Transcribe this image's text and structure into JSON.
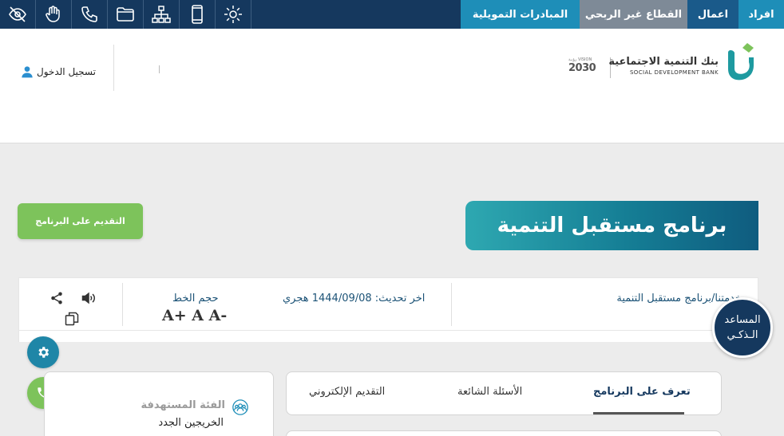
{
  "topbar": {
    "tabs": [
      {
        "label": "افراد",
        "bg": "#1e8eb8",
        "width": 57
      },
      {
        "label": "اعمال",
        "bg": "#1a5a8a",
        "width": 64
      },
      {
        "label": "القطاع غير الربحي",
        "bg": "#7e8a97",
        "width": 135
      },
      {
        "label": "المبادرات التمويلية",
        "bg": "#1e8eb8",
        "width": 149
      }
    ],
    "icons": [
      "accessibility-icon",
      "sign-language-icon",
      "phone-icon",
      "folder-icon",
      "sitemap-icon",
      "mobile-icon",
      "settings-gear-icon"
    ]
  },
  "header": {
    "login_label": "تسجيل الدخول",
    "bank_name_ar": "بنك التنمية الاجتماعية",
    "bank_name_en": "SOCIAL DEVELOPMENT BANK",
    "vision_label": "رؤيـة VISION",
    "vision_year": "2030"
  },
  "page": {
    "title": "برنامج مستقبل التنمية",
    "apply_button": "التقديم على البرنامج",
    "breadcrumb": "خدمتنا/برنامج مستقبل التنمية",
    "last_update": "اخر تحديث: 1444/09/08 هجري",
    "font_size_label": "حجم الخط",
    "font_sizes": "A+ A A-"
  },
  "assistant": {
    "line1": "المساعد",
    "line2": "الـذكـي"
  },
  "tabs": {
    "items": [
      {
        "label": "تعرف على البرنامج",
        "active": true
      },
      {
        "label": "الأسئلة الشائعة",
        "active": false
      },
      {
        "label": "التقديم الإلكتروني",
        "active": false
      }
    ]
  },
  "target_group": {
    "title": "الفئة المستهدفة",
    "value": "الخريجين الجدد"
  },
  "colors": {
    "navy": "#15385e",
    "teal": "#1e8eb8",
    "green": "#7dc35b",
    "gray_tab": "#7e8a97"
  }
}
